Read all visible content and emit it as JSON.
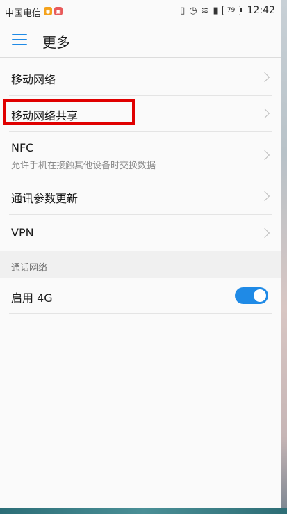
{
  "status_bar": {
    "carrier": "中国电信",
    "battery": "79",
    "time": "12:42",
    "icons": [
      "vibrate-icon",
      "alarm-icon",
      "wifi-icon",
      "signal-icon",
      "battery-icon"
    ]
  },
  "header": {
    "title": "更多"
  },
  "list": {
    "items": [
      {
        "label": "移动网络"
      },
      {
        "label": "移动网络共享"
      },
      {
        "label": "NFC",
        "subtitle": "允许手机在接触其他设备时交换数据"
      },
      {
        "label": "通讯参数更新"
      },
      {
        "label": "VPN"
      }
    ]
  },
  "section": {
    "title": "通话网络",
    "items": [
      {
        "label": "启用 4G",
        "enabled": true
      }
    ]
  },
  "colors": {
    "accent": "#1f8ae6",
    "highlight": "#e00000"
  }
}
